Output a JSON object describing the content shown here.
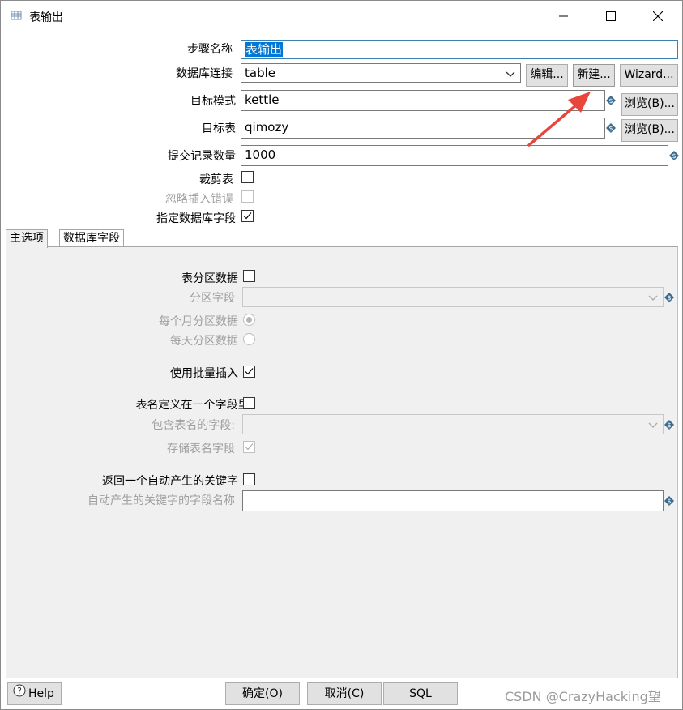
{
  "window": {
    "title": "表输出"
  },
  "form": {
    "step_name_label": "步骤名称",
    "step_name_value": "表输出",
    "connection_label": "数据库连接",
    "connection_value": "table",
    "edit_button": "编辑...",
    "new_button": "新建...",
    "wizard_button": "Wizard...",
    "schema_label": "目标模式",
    "schema_value": "kettle",
    "browse_schema_button": "浏览(B)...",
    "table_label": "目标表",
    "table_value": "qimozy",
    "browse_table_button": "浏览(B)...",
    "commit_label": "提交记录数量",
    "commit_value": "1000",
    "truncate_label": "裁剪表",
    "ignore_errors_label": "忽略插入错误",
    "specify_fields_label": "指定数据库字段"
  },
  "tabs": [
    {
      "label": "主选项"
    },
    {
      "label": "数据库字段"
    }
  ],
  "main_tab": {
    "partition_label": "表分区数据",
    "partition_field_label": "分区字段",
    "partition_monthly_label": "每个月分区数据",
    "partition_daily_label": "每天分区数据",
    "batch_insert_label": "使用批量插入",
    "table_in_field_label": "表名定义在一个字段里?",
    "table_name_field_label": "包含表名的字段:",
    "store_table_name_label": "存储表名字段",
    "return_key_label": "返回一个自动产生的关键字",
    "key_field_name_label": "自动产生的关键字的字段名称"
  },
  "state": {
    "truncate": false,
    "ignore_errors": false,
    "specify_fields": true,
    "partition": false,
    "partition_monthly_selected": true,
    "batch_insert": true,
    "table_in_field": false,
    "store_table_name": true,
    "return_key": false
  },
  "footer": {
    "help_button": "Help",
    "ok_button": "确定(O)",
    "cancel_button": "取消(C)",
    "sql_button": "SQL",
    "watermark": "CSDN @CrazyHacking望"
  },
  "colors": {
    "annotation_arrow": "#e8453c",
    "selection": "#0078d7"
  }
}
